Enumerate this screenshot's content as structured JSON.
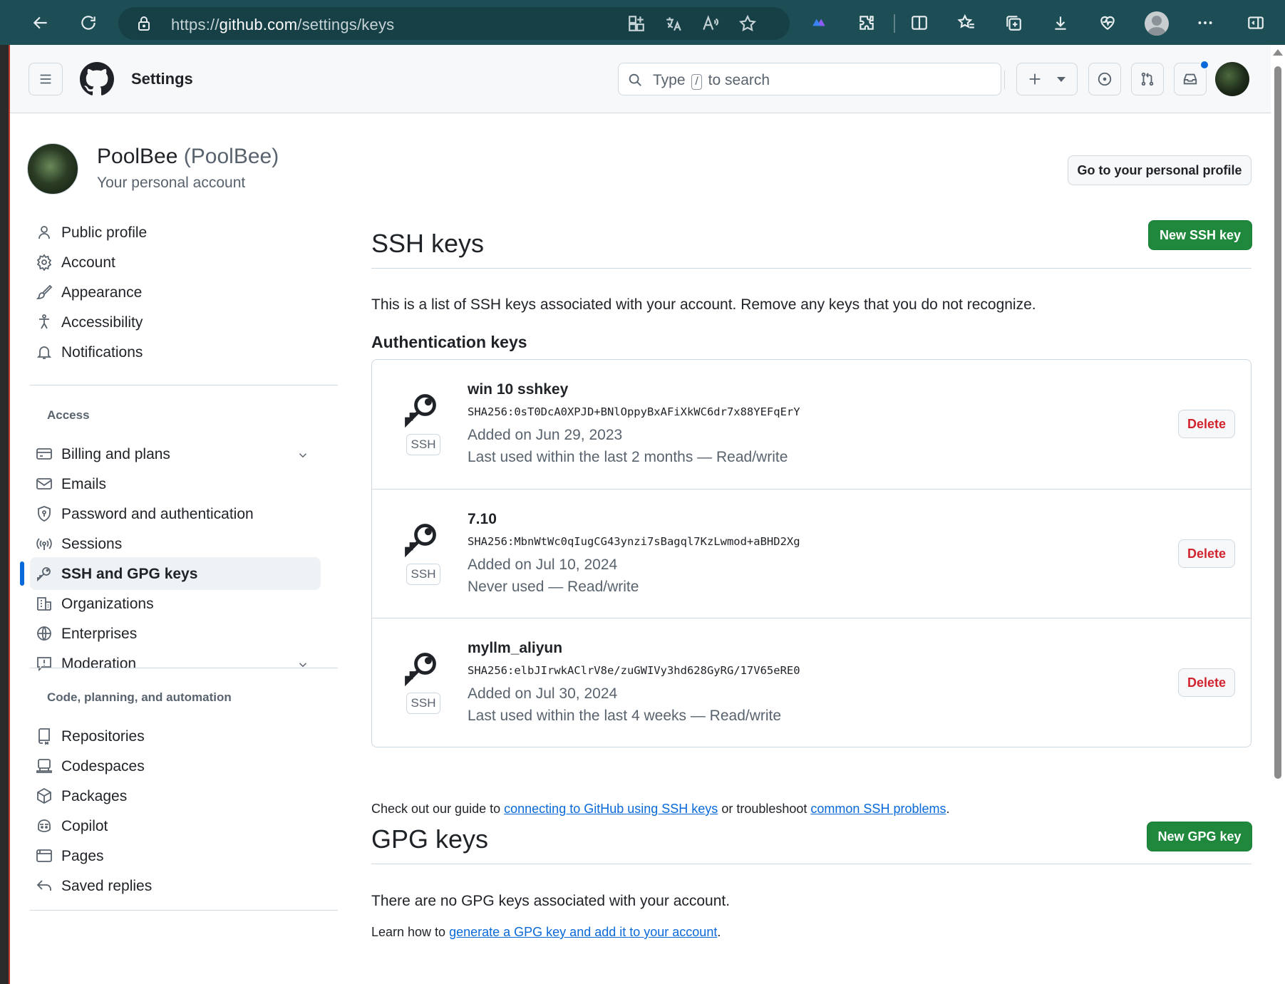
{
  "browser": {
    "url_prefix": "https://",
    "url_host": "github.com",
    "url_path": "/settings/keys"
  },
  "header": {
    "title": "Settings",
    "search_placeholder_before": "Type",
    "search_key": "/",
    "search_placeholder_after": "to search"
  },
  "profile": {
    "name": "PoolBee",
    "handle": "(PoolBee)",
    "subtitle": "Your personal account",
    "go_to_profile": "Go to your personal profile"
  },
  "sidebar": {
    "items": [
      {
        "label": "Public profile",
        "icon": "person-icon"
      },
      {
        "label": "Account",
        "icon": "gear-icon"
      },
      {
        "label": "Appearance",
        "icon": "paintbrush-icon"
      },
      {
        "label": "Accessibility",
        "icon": "accessibility-icon"
      },
      {
        "label": "Notifications",
        "icon": "bell-icon"
      }
    ],
    "access_heading": "Access",
    "access_items": [
      {
        "label": "Billing and plans",
        "icon": "credit-card-icon"
      },
      {
        "label": "Emails",
        "icon": "mail-icon"
      },
      {
        "label": "Password and authentication",
        "icon": "shield-lock-icon"
      },
      {
        "label": "Sessions",
        "icon": "broadcast-icon"
      },
      {
        "label": "SSH and GPG keys",
        "icon": "key-icon"
      },
      {
        "label": "Organizations",
        "icon": "organization-icon"
      },
      {
        "label": "Enterprises",
        "icon": "globe-icon"
      },
      {
        "label": "Moderation",
        "icon": "report-icon"
      }
    ],
    "code_heading": "Code, planning, and automation",
    "code_items": [
      {
        "label": "Repositories",
        "icon": "repo-icon"
      },
      {
        "label": "Codespaces",
        "icon": "codespaces-icon"
      },
      {
        "label": "Packages",
        "icon": "package-icon"
      },
      {
        "label": "Copilot",
        "icon": "copilot-icon"
      },
      {
        "label": "Pages",
        "icon": "browser-icon"
      },
      {
        "label": "Saved replies",
        "icon": "reply-icon"
      }
    ]
  },
  "ssh": {
    "title": "SSH keys",
    "new_button": "New SSH key",
    "description": "This is a list of SSH keys associated with your account. Remove any keys that you do not recognize.",
    "auth_heading": "Authentication keys",
    "keys": [
      {
        "title": "win 10 sshkey",
        "fingerprint": "SHA256:0sT0DcA0XPJD+BNlOppyBxAFiXkWC6dr7x88YEFqErY",
        "added": "Added on Jun 29, 2023",
        "usage": "Last used within the last 2 months — Read/write",
        "badge": "SSH",
        "delete": "Delete"
      },
      {
        "title": "7.10",
        "fingerprint": "SHA256:MbnWtWc0qIugCG43ynzi7sBagql7KzLwmod+aBHD2Xg",
        "added": "Added on Jul 10, 2024",
        "usage": "Never used — Read/write",
        "badge": "SSH",
        "delete": "Delete"
      },
      {
        "title": "myllm_aliyun",
        "fingerprint": "SHA256:elbJIrwkAClrV8e/zuGWIVy3hd628GyRG/17V65eRE0",
        "added": "Added on Jul 30, 2024",
        "usage": "Last used within the last 4 weeks — Read/write",
        "badge": "SSH",
        "delete": "Delete"
      }
    ],
    "guide_before": "Check out our guide to",
    "guide_link1": "connecting to GitHub using SSH keys",
    "guide_middle": "or troubleshoot",
    "guide_link2": "common SSH problems",
    "guide_end": "."
  },
  "gpg": {
    "title": "GPG keys",
    "new_button": "New GPG key",
    "empty_text": "There are no GPG keys associated with your account.",
    "learn_before": "Learn how to",
    "learn_link": "generate a GPG key and add it to your account",
    "learn_end": "."
  },
  "colors": {
    "accent_blue": "#0969da",
    "primary_green": "#1f883d",
    "danger_red": "#d1242f",
    "browser_chrome": "#1d4d55"
  }
}
